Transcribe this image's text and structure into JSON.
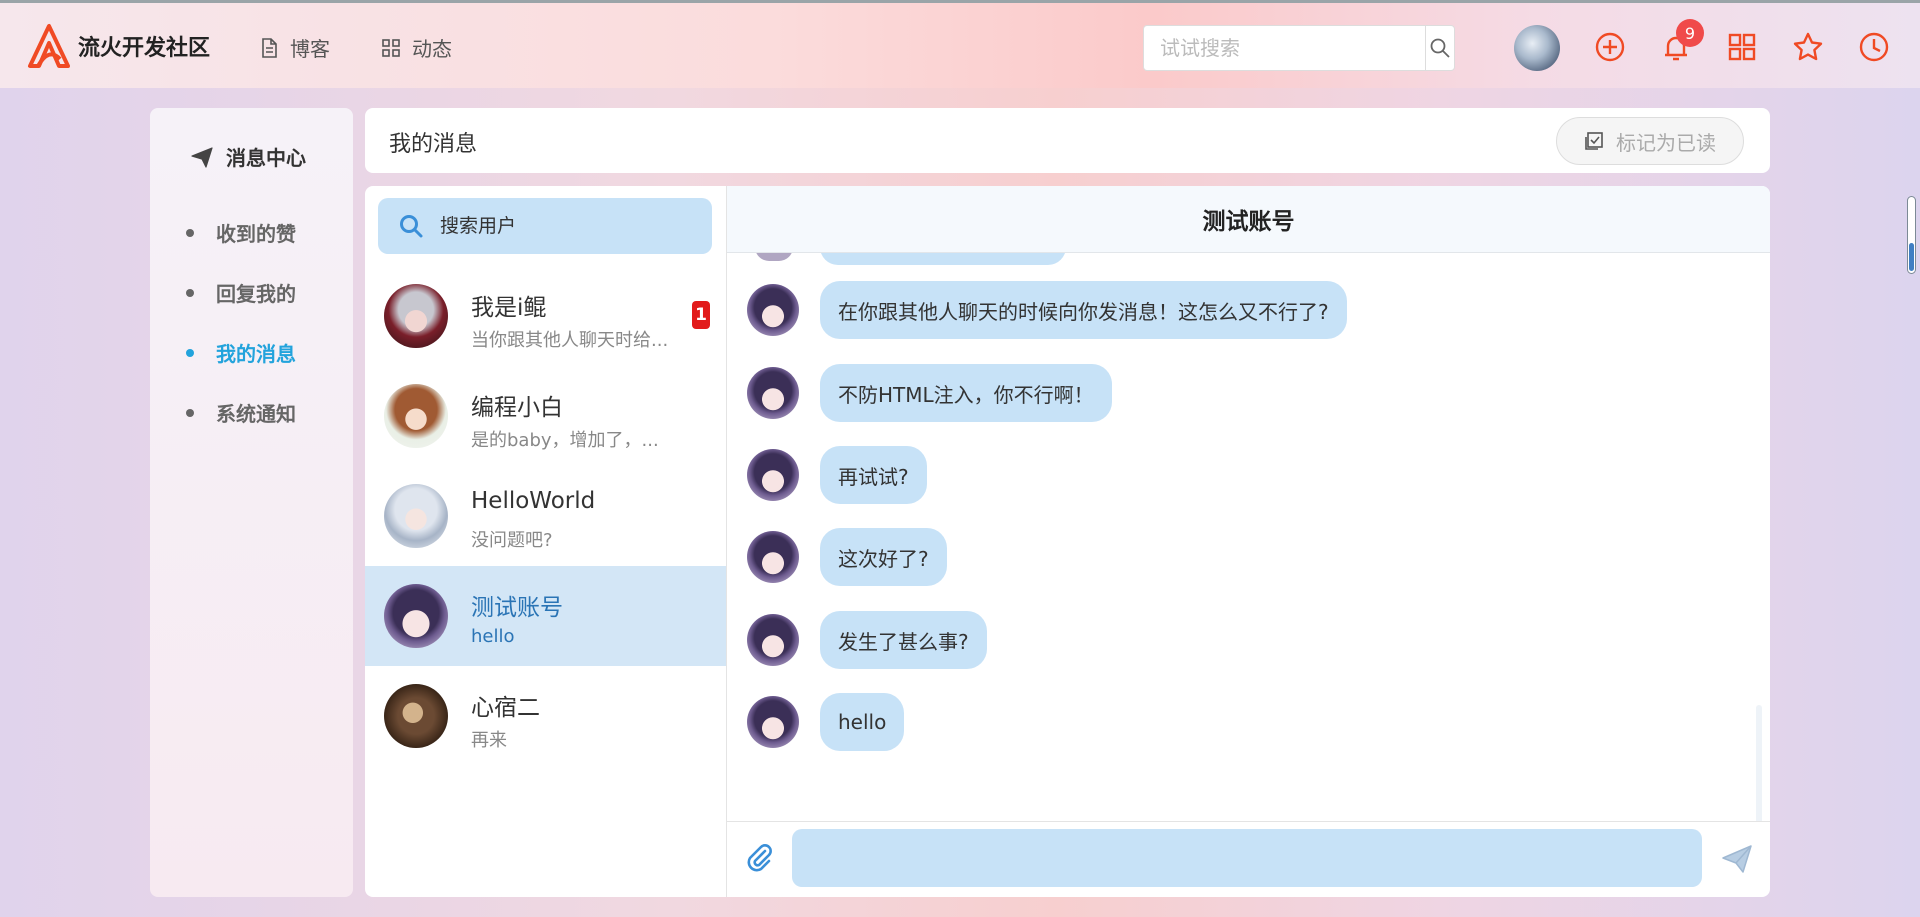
{
  "header": {
    "brand_name": "流火开发社区",
    "nav": [
      {
        "label": "博客",
        "icon": "document-icon"
      },
      {
        "label": "动态",
        "icon": "grid-icon"
      }
    ],
    "search_placeholder": "试试搜索",
    "notification_count": "9",
    "accent_color": "#f04a24"
  },
  "sidebar": {
    "title": "消息中心",
    "items": [
      {
        "label": "收到的赞",
        "active": false
      },
      {
        "label": "回复我的",
        "active": false
      },
      {
        "label": "我的消息",
        "active": true
      },
      {
        "label": "系统通知",
        "active": false
      }
    ]
  },
  "main": {
    "title": "我的消息",
    "mark_read_label": "标记为已读"
  },
  "contacts": {
    "search_placeholder": "搜索用户",
    "list": [
      {
        "name": "我是i鲲",
        "preview": "当你跟其他人聊天时给...",
        "unread": "1",
        "active": false
      },
      {
        "name": "编程小白",
        "preview": "是的baby，增加了，...",
        "unread": "",
        "active": false
      },
      {
        "name": "HelloWorld",
        "preview": "没问题吧?",
        "unread": "",
        "active": false
      },
      {
        "name": "测试账号",
        "preview": "hello",
        "unread": "",
        "active": true
      },
      {
        "name": "心宿二",
        "preview": "再来",
        "unread": "",
        "active": false
      }
    ]
  },
  "chat": {
    "title": "测试账号",
    "messages": [
      {
        "text": "在你跟其他人聊天的时候向你发消息！这怎么又不行了?"
      },
      {
        "text": "不防HTML注入，你不行啊！"
      },
      {
        "text": "再试试?"
      },
      {
        "text": "这次好了?"
      },
      {
        "text": "发生了甚么事?"
      },
      {
        "text": "hello"
      }
    ],
    "input_value": ""
  }
}
